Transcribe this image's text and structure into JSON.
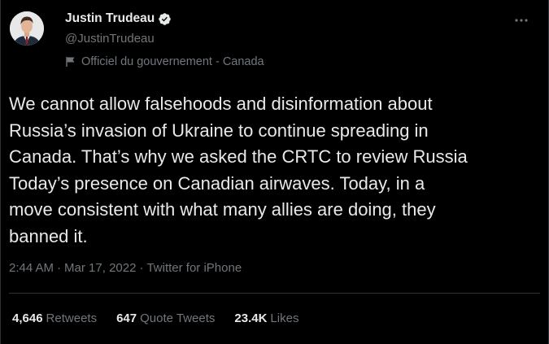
{
  "author": {
    "display_name": "Justin Trudeau",
    "handle": "@JustinTrudeau",
    "label": "Officiel du gouvernement - Canada",
    "verified": true
  },
  "tweet": {
    "text": "We cannot allow falsehoods and disinformation about\nRussia’s invasion of Ukraine to continue spreading in\nCanada. That’s why we asked the CRTC to review Russia\nToday’s presence on Canadian airwaves. Today, in a\nmove consistent with what many allies are doing, they\nbanned it.",
    "time": "2:44 AM",
    "date": "Mar 17, 2022",
    "source": "Twitter for iPhone",
    "separator": "·"
  },
  "stats": {
    "retweets": {
      "count": "4,646",
      "label": "Retweets"
    },
    "quote_tweets": {
      "count": "647",
      "label": "Quote Tweets"
    },
    "likes": {
      "count": "23.4K",
      "label": "Likes"
    }
  },
  "icons": {
    "verified": "verified-badge-icon",
    "flag": "flag-icon",
    "more": "more-horizontal-icon"
  },
  "colors": {
    "background": "#000000",
    "text_primary": "#e7e9ea",
    "text_secondary": "#71767b",
    "divider": "#2f3336"
  }
}
